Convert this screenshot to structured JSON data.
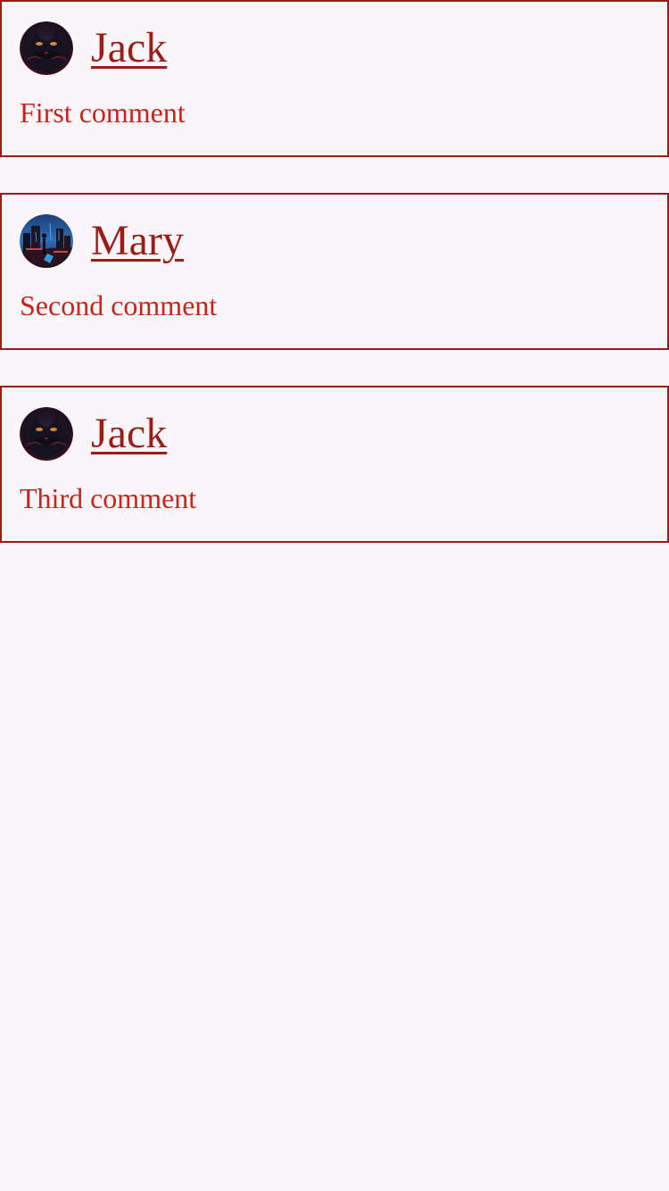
{
  "colors": {
    "background": "#faf5f9",
    "border": "#9a1d17",
    "author_text": "#9a1d17",
    "comment_text": "#c7241b"
  },
  "comments": [
    {
      "author": "Jack",
      "text": "First comment",
      "avatar_icon": "black-cat-avatar-icon"
    },
    {
      "author": "Mary",
      "text": "Second comment",
      "avatar_icon": "night-city-avatar-icon"
    },
    {
      "author": "Jack",
      "text": "Third comment",
      "avatar_icon": "black-cat-avatar-icon"
    }
  ]
}
